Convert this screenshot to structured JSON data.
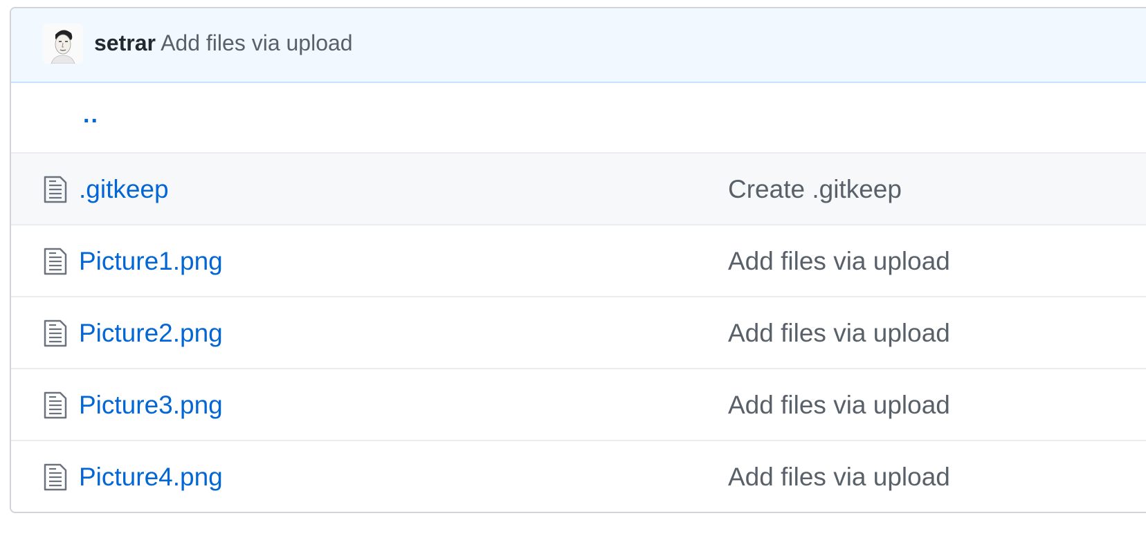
{
  "commit": {
    "author": "setrar",
    "message": "Add files via upload"
  },
  "parent_link": "..",
  "files": [
    {
      "name": ".gitkeep",
      "message": "Create .gitkeep"
    },
    {
      "name": "Picture1.png",
      "message": "Add files via upload"
    },
    {
      "name": "Picture2.png",
      "message": "Add files via upload"
    },
    {
      "name": "Picture3.png",
      "message": "Add files via upload"
    },
    {
      "name": "Picture4.png",
      "message": "Add files via upload"
    }
  ],
  "colors": {
    "link": "#0366d6",
    "muted": "#586069",
    "commit_bg": "#f1f8ff"
  }
}
